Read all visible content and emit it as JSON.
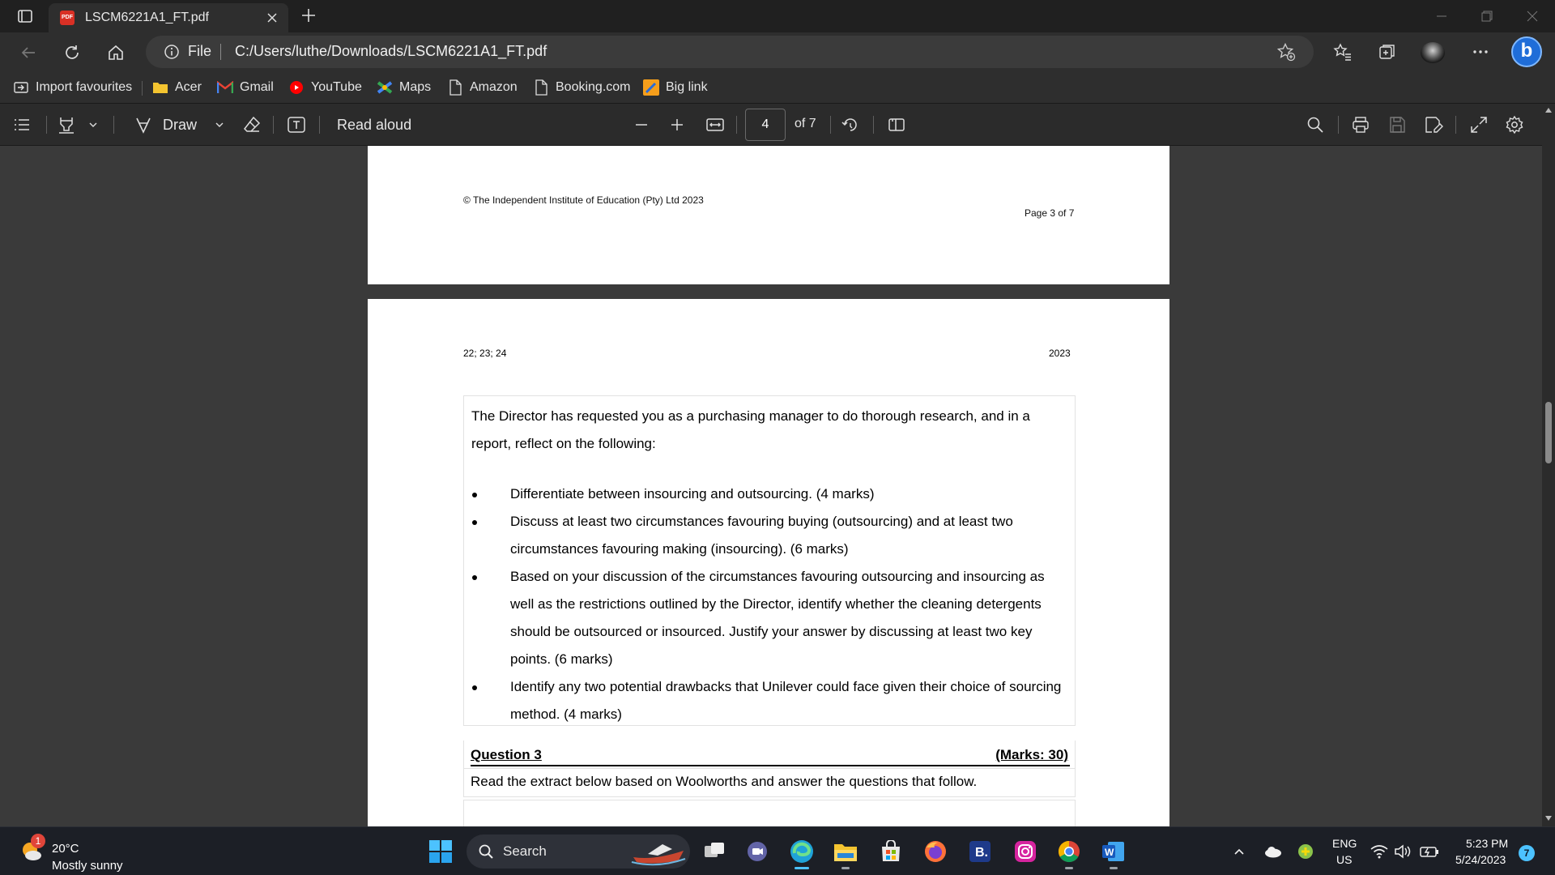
{
  "tab": {
    "title": "LSCM6221A1_FT.pdf",
    "favicon_text": "PDF"
  },
  "address": {
    "site_label": "File",
    "url": "C:/Users/luthe/Downloads/LSCM6221A1_FT.pdf"
  },
  "favourites": [
    {
      "label": "Import favourites",
      "icon": "import-icon"
    },
    {
      "label": "Acer",
      "icon": "folder-icon"
    },
    {
      "label": "Gmail",
      "icon": "gmail-icon"
    },
    {
      "label": "YouTube",
      "icon": "youtube-icon"
    },
    {
      "label": "Maps",
      "icon": "maps-icon"
    },
    {
      "label": "Amazon",
      "icon": "page-icon"
    },
    {
      "label": "Booking.com",
      "icon": "page-icon"
    },
    {
      "label": "Big link",
      "icon": "link-icon"
    }
  ],
  "pdf_toolbar": {
    "draw_label": "Draw",
    "read_aloud_label": "Read aloud",
    "current_page": "4",
    "page_total": "of 7"
  },
  "document": {
    "page3": {
      "copyright": "© The Independent Institute of Education (Pty) Ltd 2023",
      "page_number": "Page 3 of 7"
    },
    "page4": {
      "header_left": "22; 23; 24",
      "header_right": "2023",
      "intro": "The Director has requested you as a purchasing manager to do thorough research, and in a report, reflect on the following:",
      "bullets": [
        "Differentiate between insourcing and outsourcing. (4 marks)",
        "Discuss at least two circumstances favouring buying (outsourcing) and at least two circumstances favouring making (insourcing). (6 marks)",
        "Based on your discussion of the circumstances favouring outsourcing and insourcing as well as the restrictions outlined by the Director, identify whether the cleaning detergents should be outsourced or insourced. Justify your answer by discussing at least two key points. (6 marks)",
        "Identify any two potential drawbacks that Unilever could face given their choice of sourcing method. (4 marks)"
      ],
      "question_title": "Question 3",
      "question_marks": "(Marks: 30)",
      "question_text": "Read the extract below based on Woolworths and answer the questions that follow."
    }
  },
  "taskbar": {
    "weather_badge": "1",
    "temperature": "20°C",
    "condition": "Mostly sunny",
    "search_label": "Search",
    "lang_line1": "ENG",
    "lang_line2": "US",
    "time": "5:23 PM",
    "date": "5/24/2023",
    "notification_count": "7"
  },
  "colors": {
    "accent": "#0078d4",
    "pdf_red": "#d93025",
    "viewer_bg": "#3a3a3a"
  }
}
